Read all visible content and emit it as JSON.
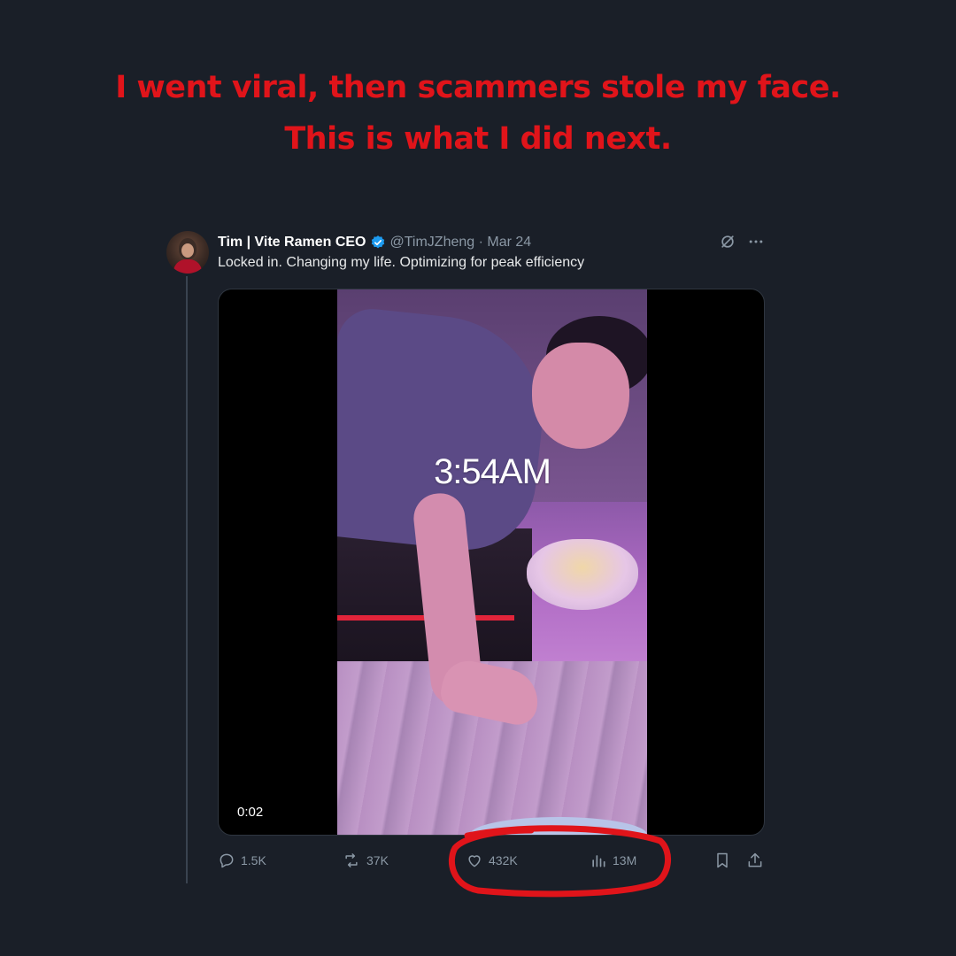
{
  "headline": {
    "line1": "I went viral, then scammers stole my face.",
    "line2": "This is what I did next.",
    "color": "#e0141a"
  },
  "tweet": {
    "author_name": "Tim | Vite Ramen CEO",
    "handle_date": "@TimJZheng · Mar 24",
    "text": "Locked in. Changing my life. Optimizing for peak efficiency",
    "video_overlay_text": "3:54AM",
    "video_duration": "0:02",
    "actions": {
      "replies": "1.5K",
      "reposts": "37K",
      "likes": "432K",
      "views": "13M"
    },
    "icons": {
      "verified": "verified-badge-icon",
      "grok": "grok-icon",
      "more": "more-icon",
      "reply": "reply-icon",
      "repost": "repost-icon",
      "like": "heart-icon",
      "views": "views-icon",
      "bookmark": "bookmark-icon",
      "share": "share-icon"
    },
    "accent_color": "#1d9bf0"
  },
  "background_color": "#1a1f28"
}
